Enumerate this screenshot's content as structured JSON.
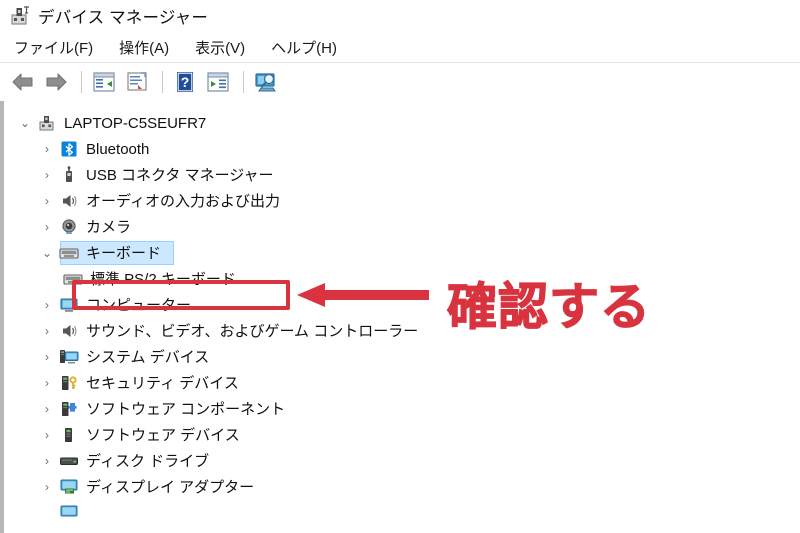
{
  "window": {
    "title": "デバイス マネージャー",
    "title_icon": "device-manager-icon"
  },
  "menubar": {
    "items": [
      {
        "label": "ファイル(F)",
        "name": "menu-file"
      },
      {
        "label": "操作(A)",
        "name": "menu-action"
      },
      {
        "label": "表示(V)",
        "name": "menu-view"
      },
      {
        "label": "ヘルプ(H)",
        "name": "menu-help"
      }
    ]
  },
  "toolbar": {
    "buttons": [
      {
        "icon": "back-arrow-icon",
        "name": "toolbar-back"
      },
      {
        "icon": "forward-arrow-icon",
        "name": "toolbar-forward"
      },
      {
        "icon": "show-hide-console-tree-icon",
        "name": "toolbar-console-tree"
      },
      {
        "icon": "properties-icon",
        "name": "toolbar-properties"
      },
      {
        "icon": "help-icon",
        "name": "toolbar-help"
      },
      {
        "icon": "update-driver-icon",
        "name": "toolbar-update-driver"
      },
      {
        "icon": "scan-hardware-changes-icon",
        "name": "toolbar-scan-hardware"
      }
    ]
  },
  "tree": {
    "root": {
      "label": "LAPTOP-C5SEUFR7",
      "icon": "computer-root-icon",
      "expanded": true
    },
    "nodes": [
      {
        "label": "Bluetooth",
        "icon": "bluetooth-icon",
        "expanded": false,
        "depth": 1
      },
      {
        "label": "USB コネクタ マネージャー",
        "icon": "usb-icon",
        "expanded": false,
        "depth": 1
      },
      {
        "label": "オーディオの入力および出力",
        "icon": "speaker-icon",
        "expanded": false,
        "depth": 1
      },
      {
        "label": "カメラ",
        "icon": "camera-icon",
        "expanded": false,
        "depth": 1
      },
      {
        "label": "キーボード",
        "icon": "keyboard-icon",
        "expanded": true,
        "depth": 1,
        "selected": true
      },
      {
        "label": "標準 PS/2 キーボード",
        "icon": "keyboard-device-icon",
        "expanded": null,
        "depth": 2,
        "highlighted": true
      },
      {
        "label": "コンピューター",
        "icon": "monitor-icon",
        "expanded": false,
        "depth": 1
      },
      {
        "label": "サウンド、ビデオ、およびゲーム コントローラー",
        "icon": "speaker-icon",
        "expanded": false,
        "depth": 1
      },
      {
        "label": "システム デバイス",
        "icon": "system-device-icon",
        "expanded": false,
        "depth": 1
      },
      {
        "label": "セキュリティ デバイス",
        "icon": "security-device-icon",
        "expanded": false,
        "depth": 1
      },
      {
        "label": "ソフトウェア コンポーネント",
        "icon": "software-component-icon",
        "expanded": false,
        "depth": 1
      },
      {
        "label": "ソフトウェア デバイス",
        "icon": "software-device-icon",
        "expanded": false,
        "depth": 1
      },
      {
        "label": "ディスク ドライブ",
        "icon": "disk-drive-icon",
        "expanded": false,
        "depth": 1
      },
      {
        "label": "ディスプレイ アダプター",
        "icon": "display-adapter-icon",
        "expanded": false,
        "depth": 1
      }
    ],
    "twisty_collapsed": "›",
    "twisty_expanded": "⌄"
  },
  "annotation": {
    "text": "確認する",
    "color": "#d8333f",
    "arrow": "left-arrow-annotation",
    "box": "red-highlight-box"
  },
  "colors": {
    "selection_bg": "#cce8ff",
    "annotation_red": "#d8333f",
    "window_border": "#b7b7b7"
  }
}
